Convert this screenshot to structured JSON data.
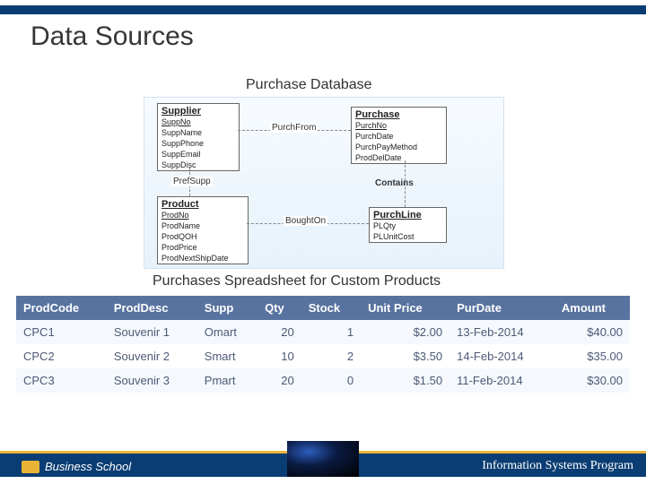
{
  "title": "Data Sources",
  "erd": {
    "subtitle": "Purchase Database",
    "entities": {
      "supplier": {
        "name": "Supplier",
        "attrs": [
          "SuppNo",
          "SuppName",
          "SuppPhone",
          "SuppEmail",
          "SuppDisc"
        ]
      },
      "purchase": {
        "name": "Purchase",
        "attrs": [
          "PurchNo",
          "PurchDate",
          "PurchPayMethod",
          "ProdDelDate"
        ]
      },
      "product": {
        "name": "Product",
        "attrs": [
          "ProdNo",
          "ProdName",
          "ProdQOH",
          "ProdPrice",
          "ProdNextShipDate"
        ]
      },
      "purchline": {
        "name": "PurchLine",
        "attrs": [
          "PLQty",
          "PLUnitCost"
        ]
      }
    },
    "rels": {
      "purchfrom": "PurchFrom",
      "prefsupp": "PrefSupp",
      "contains": "Contains",
      "boughton": "BoughtOn"
    }
  },
  "spreadsheet": {
    "subtitle": "Purchases Spreadsheet for Custom Products",
    "headers": [
      "ProdCode",
      "ProdDesc",
      "Supp",
      "Qty",
      "Stock",
      "Unit Price",
      "PurDate",
      "Amount"
    ],
    "rows": [
      {
        "code": "CPC1",
        "desc": "Souvenir 1",
        "supp": "Omart",
        "qty": "20",
        "stock": "1",
        "price": "$2.00",
        "date": "13-Feb-2014",
        "amount": "$40.00"
      },
      {
        "code": "CPC2",
        "desc": "Souvenir 2",
        "supp": "Smart",
        "qty": "10",
        "stock": "2",
        "price": "$3.50",
        "date": "14-Feb-2014",
        "amount": "$35.00"
      },
      {
        "code": "CPC3",
        "desc": "Souvenir 3",
        "supp": "Pmart",
        "qty": "20",
        "stock": "0",
        "price": "$1.50",
        "date": "11-Feb-2014",
        "amount": "$30.00"
      }
    ]
  },
  "footer": {
    "logo": "Business School",
    "program": "Information Systems Program"
  }
}
